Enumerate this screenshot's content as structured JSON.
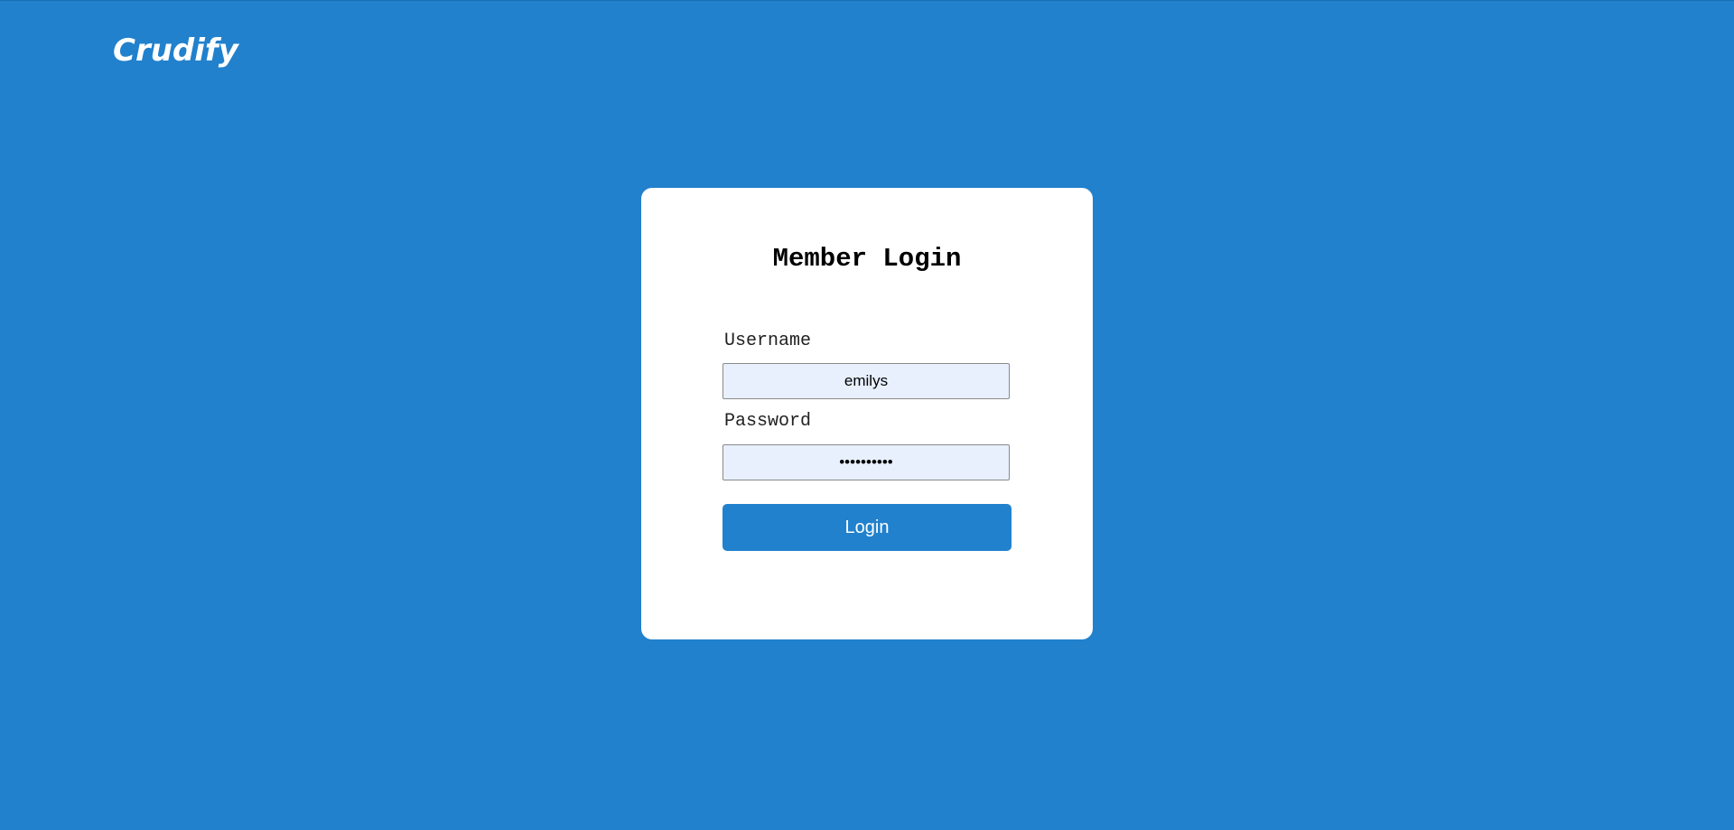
{
  "brand": {
    "logo_text": "Crudify"
  },
  "login_card": {
    "title": "Member Login",
    "username_label": "Username",
    "username_value": "emilys",
    "password_label": "Password",
    "password_value": "emilyspass",
    "login_button_label": "Login"
  },
  "colors": {
    "background": "#2181cd",
    "card": "#ffffff",
    "input_background": "#e8f0fe",
    "button": "#2181cd"
  }
}
